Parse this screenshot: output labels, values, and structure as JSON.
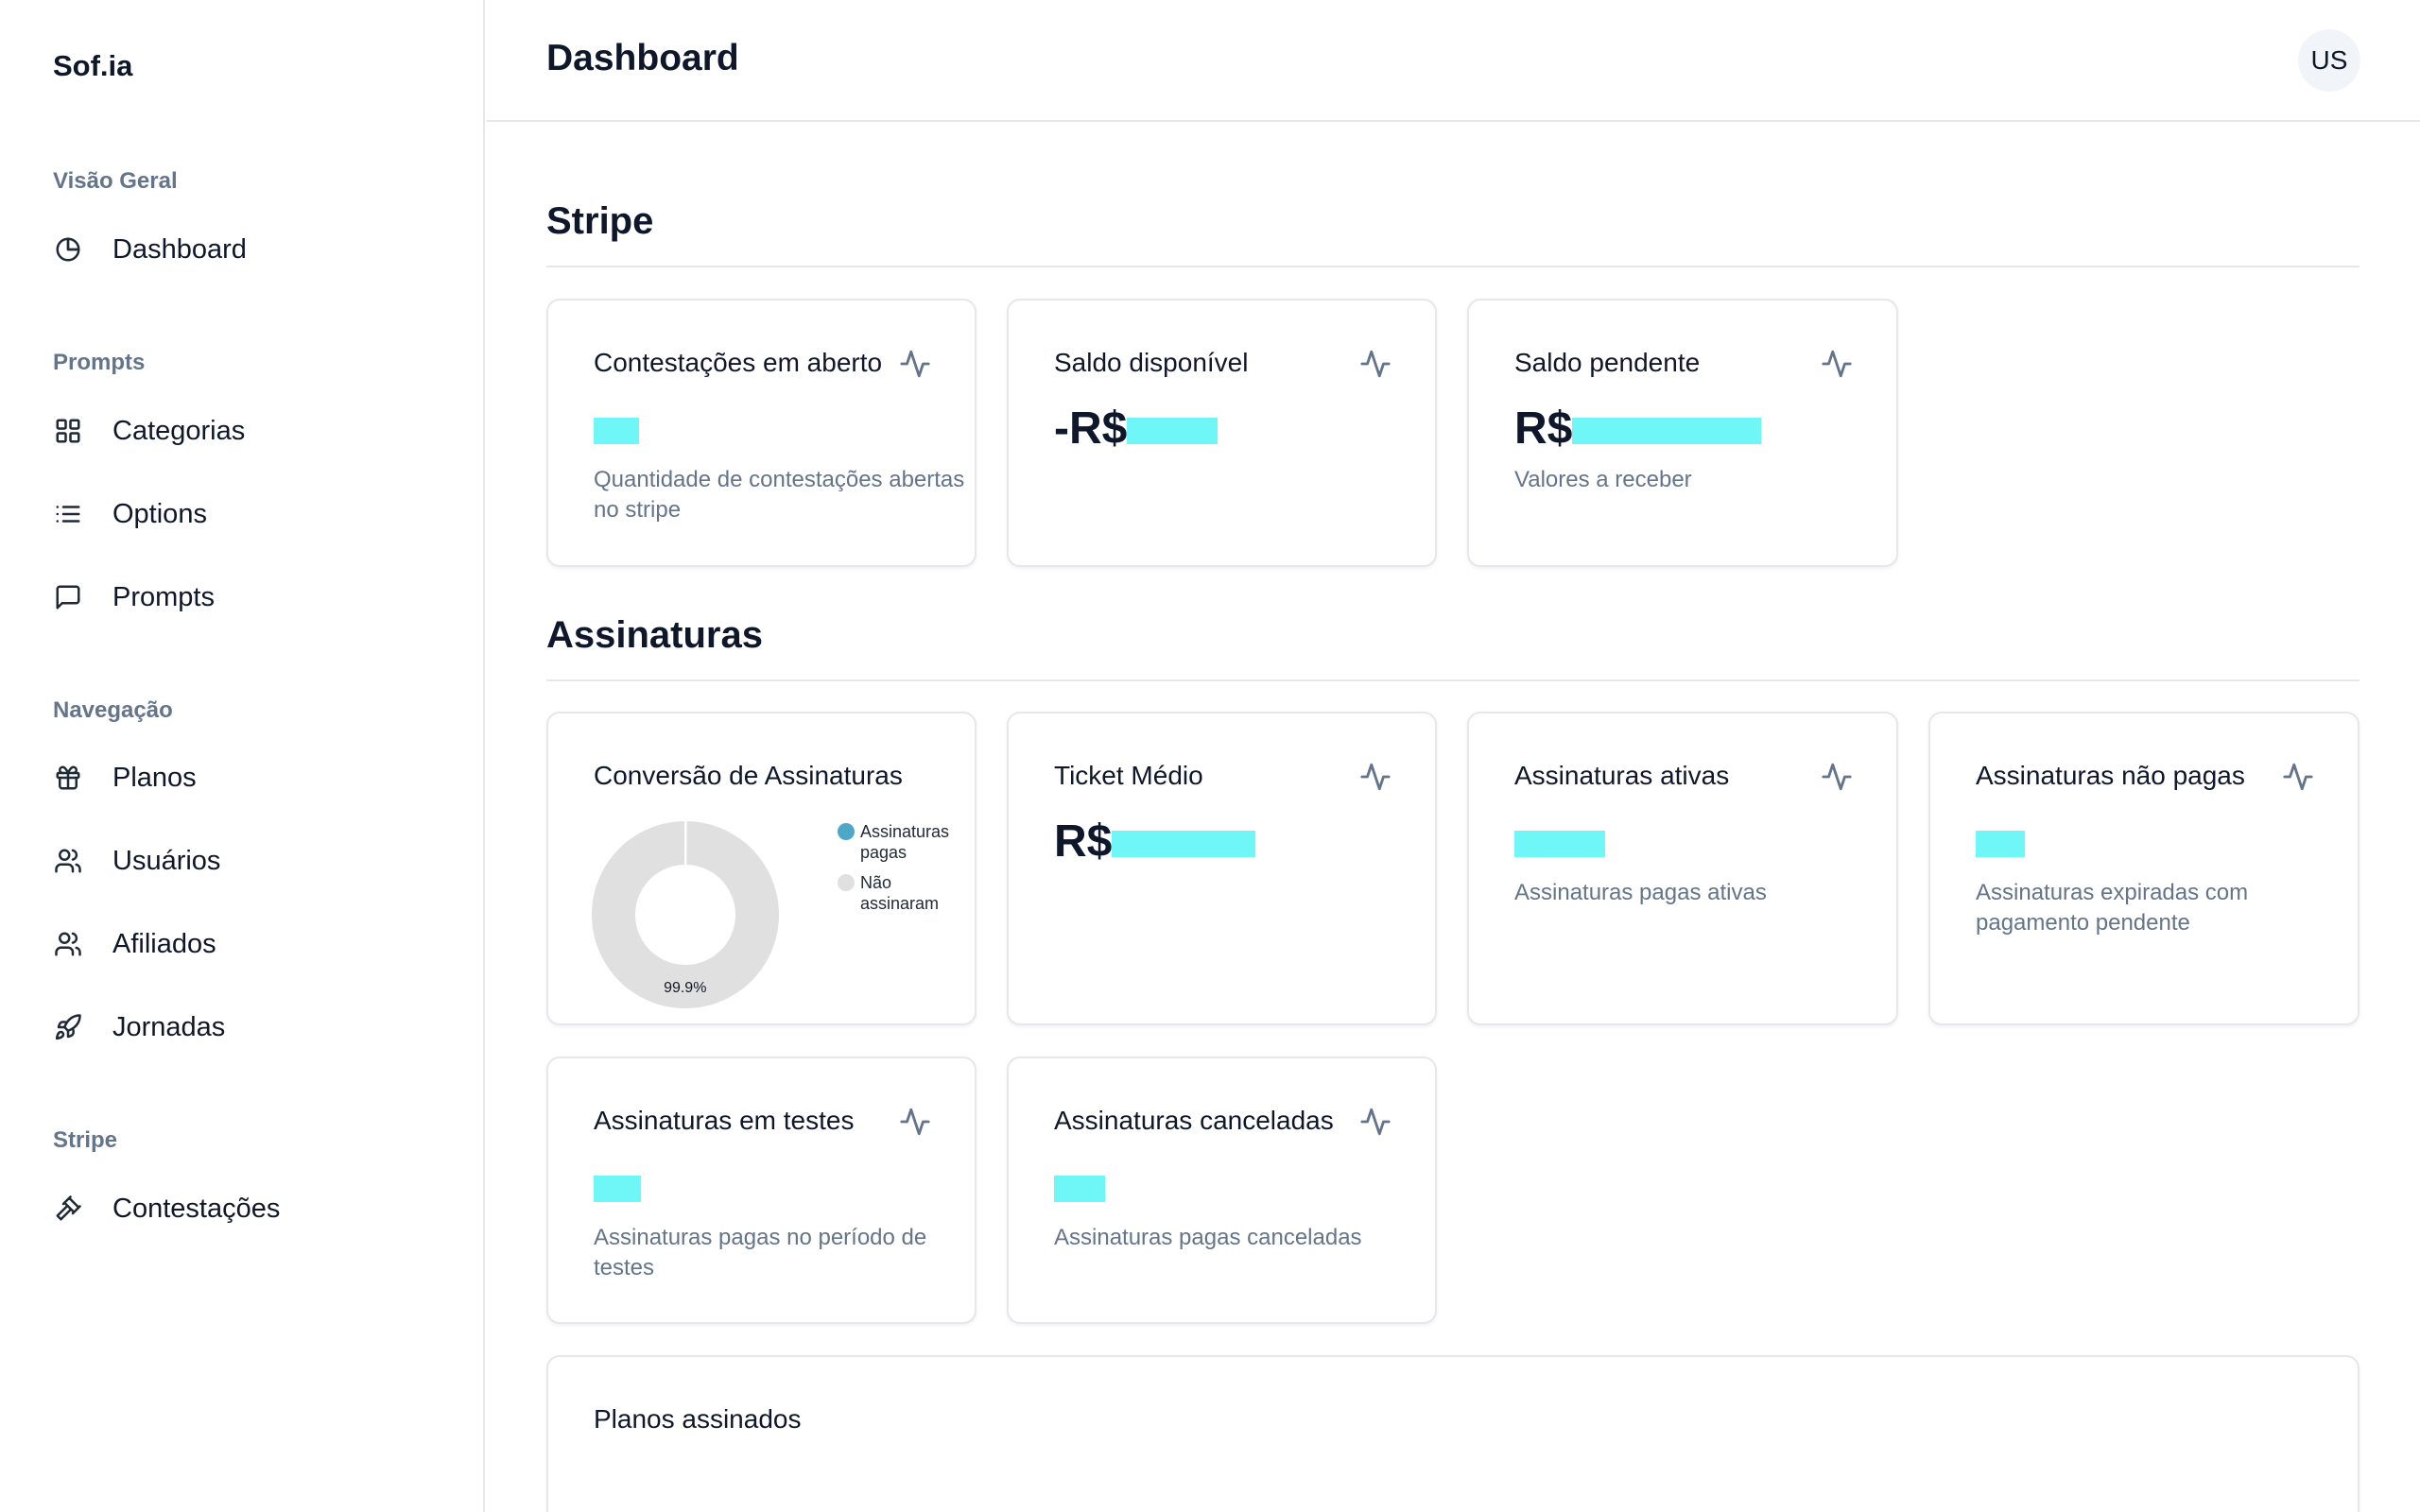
{
  "sidebar": {
    "brand": "Sof.ia",
    "groups": [
      {
        "title": "Visão Geral",
        "items": [
          {
            "label": "Dashboard",
            "icon": "pie-chart-icon"
          }
        ]
      },
      {
        "title": "Prompts",
        "items": [
          {
            "label": "Categorias",
            "icon": "grid-icon"
          },
          {
            "label": "Options",
            "icon": "list-icon"
          },
          {
            "label": "Prompts",
            "icon": "message-square-icon"
          }
        ]
      },
      {
        "title": "Navegação",
        "items": [
          {
            "label": "Planos",
            "icon": "gift-icon"
          },
          {
            "label": "Usuários",
            "icon": "users-icon"
          },
          {
            "label": "Afiliados",
            "icon": "users-icon"
          },
          {
            "label": "Jornadas",
            "icon": "rocket-icon"
          }
        ]
      },
      {
        "title": "Stripe",
        "items": [
          {
            "label": "Contestações",
            "icon": "gavel-icon"
          }
        ]
      }
    ]
  },
  "header": {
    "title": "Dashboard",
    "avatar": "US"
  },
  "stripe": {
    "title": "Stripe",
    "cards": [
      {
        "title": "Contestações em aberto",
        "value": "",
        "desc": "Quantidade de contestações abertas no stripe",
        "icon": "activity-icon"
      },
      {
        "title": "Saldo disponível",
        "value": "-R$",
        "desc": "",
        "icon": "activity-icon"
      },
      {
        "title": "Saldo pendente",
        "value": "R$",
        "desc": "Valores a receber",
        "icon": "activity-icon"
      }
    ]
  },
  "subscriptions": {
    "title": "Assinaturas",
    "conversion": {
      "title": "Conversão de Assinaturas",
      "legend": [
        "Assinaturas pagas",
        "Não assinaram"
      ],
      "percent_label": "99.9%"
    },
    "cards": [
      {
        "title": "Ticket Médio",
        "value": "R$",
        "desc": "",
        "icon": "activity-icon"
      },
      {
        "title": "Assinaturas ativas",
        "value": "",
        "desc": "Assinaturas pagas ativas",
        "icon": "activity-icon"
      },
      {
        "title": "Assinaturas não pagas",
        "value": "",
        "desc": "Assinaturas expiradas com pagamento pendente",
        "icon": "activity-icon"
      },
      {
        "title": "Assinaturas em testes",
        "value": "",
        "desc": "Assinaturas pagas no período de testes",
        "icon": "activity-icon"
      },
      {
        "title": "Assinaturas canceladas",
        "value": "",
        "desc": "Assinaturas pagas canceladas",
        "icon": "activity-icon"
      }
    ],
    "plans_title": "Planos assinados"
  },
  "colors": {
    "paid": "#4ea7c7",
    "not_subscribed": "#e0e0e0",
    "redaction": "#6ff7f7"
  },
  "chart_data": {
    "type": "pie",
    "categories": [
      "Assinaturas pagas",
      "Não assinaram"
    ],
    "values": [
      0.1,
      99.9
    ],
    "labels": [
      "",
      "99.9%"
    ]
  }
}
